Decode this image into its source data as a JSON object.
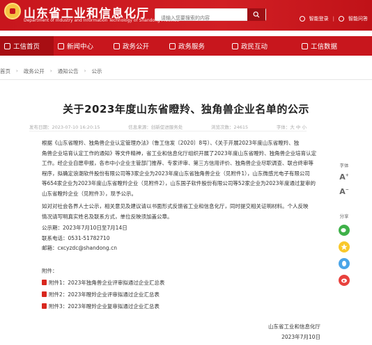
{
  "header": {
    "site_title": "山东省工业和信息化厅",
    "site_subtitle": "Department of Industry and Information Technology of Shandong Province",
    "search_placeholder": "请输入您要搜索的内容",
    "top_links": [
      "智能登录",
      "智能问答"
    ],
    "brand_color": "#c8161d"
  },
  "nav": {
    "items": [
      {
        "label": "工信首页",
        "icon": "home-icon"
      },
      {
        "label": "新闻中心",
        "icon": "news-icon"
      },
      {
        "label": "政务公开",
        "icon": "document-icon"
      },
      {
        "label": "政务服务",
        "icon": "service-icon"
      },
      {
        "label": "政民互动",
        "icon": "chat-icon"
      },
      {
        "label": "工信数据",
        "icon": "data-icon"
      }
    ]
  },
  "breadcrumb": [
    "首页",
    "政务公开",
    "通知公告",
    "公示"
  ],
  "article": {
    "title": "关于2023年度山东省瞪羚、独角兽企业名单的公示",
    "meta": {
      "date": "发布日期：2023-07-10 16:20:15",
      "source": "信息来源：创新促进服务处",
      "views": "浏览次数：24615",
      "font": "字体：大 中 小"
    },
    "paragraph1": [
      "根据《山东省瞪羚、独角兽企业认定管理办法》（鲁工信发〔2020〕8号）、《关于开展2023年度山东省瞪羚、独",
      "角兽企业培育认定工作的通知》等文件精神，省工业和信息化厅组织开展了2023年度山东省瞪羚、独角兽企业培育认定",
      "工作。经企业自愿申报，各市中小企业主管部门推荐、专家评审、第三方信用评价、独角兽企业尽职调查、联合终审等",
      "程序，拟确定浪潮软件股份有限公司等3家企业为2023年度山东省独角兽企业（见附件1），山东微感光电子有限公司",
      "等654家企业为2023年度山东省瞪羚企业（见附件2），山东国子软件股份有限公司等52家企业为2023年度通过复审的",
      "山东省瞪羚企业（见附件3），现予公示。"
    ],
    "paragraph2": [
      "如对对社会各界人士公示，相关意见及建议请以书面形式反馈省工业和信息化厅，同时提交相关证明材料。个人反映",
      "情况请写明真实姓名及联系方式，单位反映须加盖公章。"
    ],
    "publicity": {
      "period": "公示期：2023年7月10日至7月14日",
      "phone": "联系电话：0531-51782710",
      "email": "邮箱：cxcyzdc@shandong.cn"
    },
    "attachments_label": "附件：",
    "attachments": [
      "附件1：2023年独角兽企业评审拟通过企业汇总表",
      "附件2：2023年瞪羚企业评审拟通过企业汇总表",
      "附件3：2023年瞪羚企业复审拟通过企业汇总表"
    ],
    "signature": {
      "org": "山东省工业和信息化厅",
      "date": "2023年7月10日"
    }
  },
  "side": {
    "font_label": "字体",
    "font_up": "A",
    "font_down": "A",
    "share_label": "分享",
    "share_colors": [
      "#3fb149",
      "#f9c82b",
      "#4ba5e8",
      "#e8413d"
    ]
  }
}
